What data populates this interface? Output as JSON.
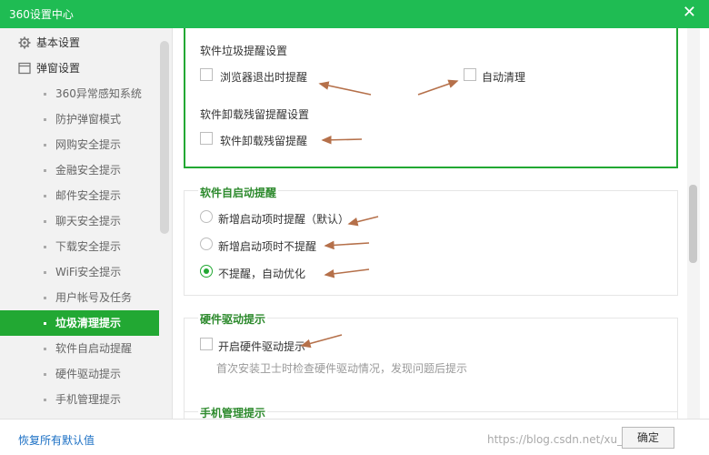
{
  "window": {
    "title": "360设置中心"
  },
  "sidebar": {
    "categories": [
      {
        "label": "基本设置",
        "icon": "gear-icon"
      },
      {
        "label": "弹窗设置",
        "icon": "window-icon"
      }
    ],
    "items": [
      {
        "label": "360异常感知系统"
      },
      {
        "label": "防护弹窗模式"
      },
      {
        "label": "网购安全提示"
      },
      {
        "label": "金融安全提示"
      },
      {
        "label": "邮件安全提示"
      },
      {
        "label": "聊天安全提示"
      },
      {
        "label": "下载安全提示"
      },
      {
        "label": "WiFi安全提示"
      },
      {
        "label": "用户帐号及任务"
      },
      {
        "label": "垃圾清理提示",
        "active": true
      },
      {
        "label": "软件自启动提醒"
      },
      {
        "label": "硬件驱动提示"
      },
      {
        "label": "手机管理提示"
      }
    ]
  },
  "main": {
    "junk_reminder": {
      "heading": "软件垃圾提醒设置",
      "browser_exit_label": "浏览器退出时提醒",
      "browser_exit_checked": false,
      "auto_clean_label": "自动清理",
      "auto_clean_checked": false
    },
    "uninstall_reminder": {
      "heading": "软件卸载残留提醒设置",
      "option_label": "软件卸载残留提醒",
      "option_checked": false
    },
    "autostart": {
      "heading": "软件自启动提醒",
      "options": [
        {
          "label": "新增启动项时提醒（默认）",
          "checked": false
        },
        {
          "label": "新增启动项时不提醒",
          "checked": false
        },
        {
          "label": "不提醒，自动优化",
          "checked": true
        }
      ]
    },
    "hardware": {
      "heading": "硬件驱动提示",
      "option_label": "开启硬件驱动提示",
      "option_checked": false,
      "description": "首次安装卫士时检查硬件驱动情况，发现问题后提示"
    },
    "phone": {
      "heading": "手机管理提示"
    }
  },
  "footer": {
    "restore_label": "恢复所有默认值",
    "ok_label": "确定",
    "watermark": "https://blog.csdn.net/xu__hanmin"
  },
  "colors": {
    "brand_green": "#1fbc53",
    "active_green": "#22a833",
    "annotation_arrow": "#b5704a",
    "link_blue": "#1a6fc4"
  }
}
